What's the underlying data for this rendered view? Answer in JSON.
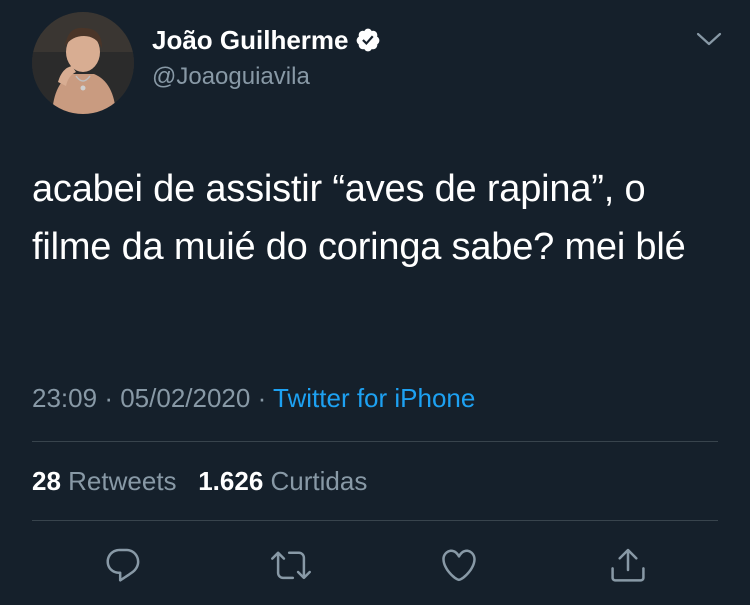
{
  "tweet": {
    "author": {
      "display_name": "João Guilherme",
      "handle": "@Joaoguiavila",
      "verified": true
    },
    "text": "acabei de assistir “aves de rapina”, o filme da muié do coringa sabe? mei blé",
    "time": "23:09",
    "date": "05/02/2020",
    "separator": "·",
    "source": "Twitter for iPhone",
    "stats": {
      "retweets_count": "28",
      "retweets_label": "Retweets",
      "likes_count": "1.626",
      "likes_label": "Curtidas"
    },
    "actions": [
      "reply-icon",
      "retweet-icon",
      "like-icon",
      "share-icon"
    ]
  },
  "colors": {
    "background": "#15202b",
    "text": "#ffffff",
    "secondary": "#8899a6",
    "link": "#1da1f2",
    "divider": "#38444d"
  }
}
